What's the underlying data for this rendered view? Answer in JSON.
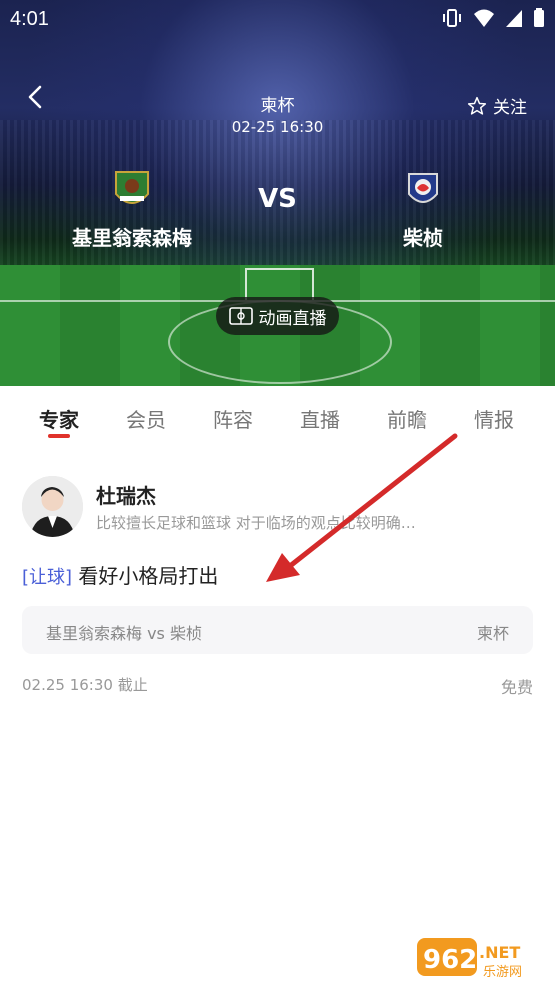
{
  "status_bar": {
    "time": "4:01",
    "icons": [
      "vibrate-icon",
      "wifi-icon",
      "cell-signal-icon",
      "battery-icon"
    ]
  },
  "header": {
    "league": "柬杯",
    "datetime": "02-25 16:30",
    "follow_label": "关注"
  },
  "match": {
    "home_team": "基里翁索森梅",
    "away_team": "柴桢",
    "vs_label": "VS",
    "live_button": "动画直播"
  },
  "tabs": [
    {
      "label": "专家",
      "active": true
    },
    {
      "label": "会员",
      "active": false
    },
    {
      "label": "阵容",
      "active": false
    },
    {
      "label": "直播",
      "active": false
    },
    {
      "label": "前瞻",
      "active": false
    },
    {
      "label": "情报",
      "active": false
    }
  ],
  "expert": {
    "name": "杜瑞杰",
    "description": "比较擅长足球和篮球 对于临场的观点比较明确…"
  },
  "pick": {
    "tag": "[让球]",
    "text": "看好小格局打出"
  },
  "match_card": {
    "teams": "基里翁索森梅 vs 柴桢",
    "league": "柬杯"
  },
  "footer": {
    "deadline": "02.25 16:30 截止",
    "price": "免费"
  },
  "watermark": {
    "text": "962.NET",
    "sub": "乐游网"
  },
  "colors": {
    "accent_red": "#e0322b",
    "tag_blue": "#4a5fd7",
    "arrow_red": "#d42a2a"
  }
}
